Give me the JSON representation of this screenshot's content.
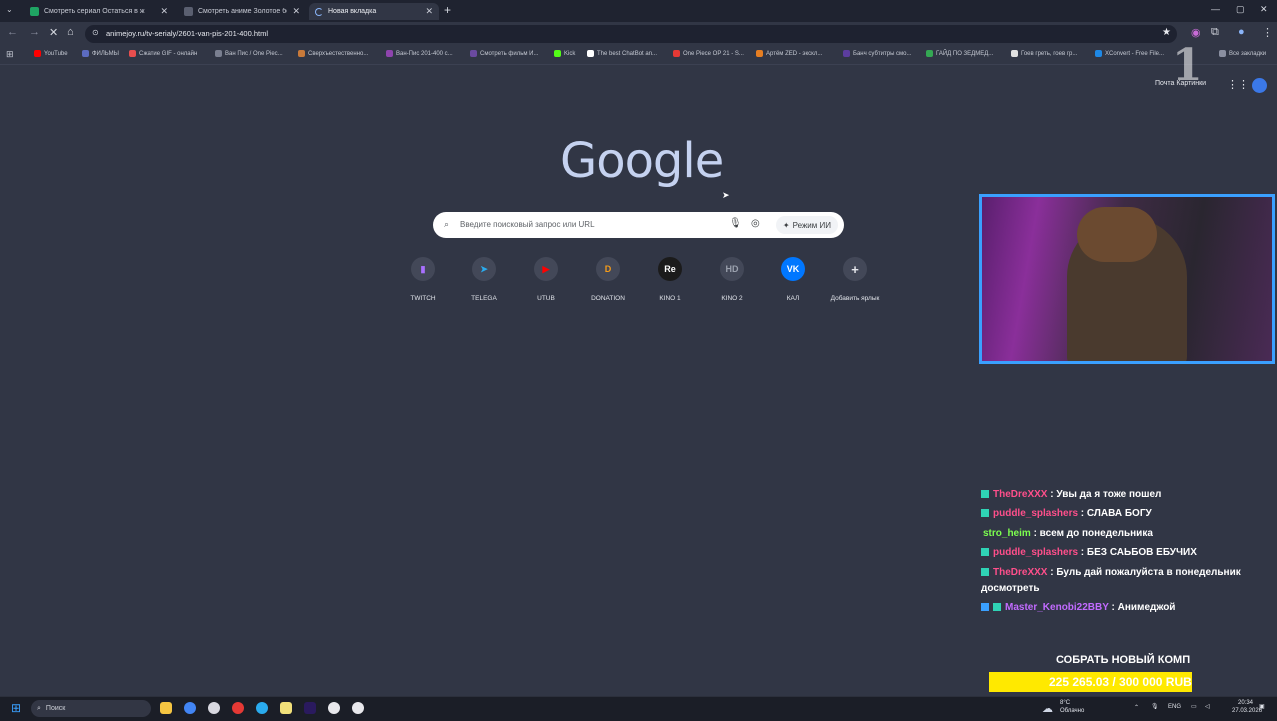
{
  "browser": {
    "tabs": [
      {
        "title": "Смотреть сериал Остаться в ж",
        "color": "#1fa463"
      },
      {
        "title": "Смотреть аниме Золотое бож",
        "color": "#5a5f70"
      },
      {
        "title": "Новая вкладка",
        "color": "#8ab4f8"
      }
    ],
    "new_tab_glyph": "+",
    "url": "animejoy.ru/tv-serialy/2601-van-pis-201-400.html",
    "bookmarks": [
      {
        "label": "YouTube",
        "color": "#ff0000"
      },
      {
        "label": "ФИЛЬМЫ",
        "color": "#5c6bc0"
      },
      {
        "label": "Сжатие GIF - онлайн",
        "color": "#e84e4e"
      },
      {
        "label": "Ван Пис / One Piec...",
        "color": "#7a7f90"
      },
      {
        "label": "Сверхъестественно...",
        "color": "#c97a3a"
      },
      {
        "label": "Ван-Пис 201-400 с...",
        "color": "#8e44ad"
      },
      {
        "label": "Смотреть фильм И...",
        "color": "#6b4aa0"
      },
      {
        "label": "Kick",
        "color": "#53fc18"
      },
      {
        "label": "The best ChatBot an...",
        "color": "#ffffff"
      },
      {
        "label": "One Piece OP 21 - S...",
        "color": "#e53935"
      },
      {
        "label": "Артём ZED - экскл...",
        "color": "#e67e22"
      },
      {
        "label": "Банч субтитры смо...",
        "color": "#5c3d9e"
      },
      {
        "label": "ГАЙД ПО ЗЕДМЕД...",
        "color": "#34a853"
      },
      {
        "label": "Гоев греть, гоев гр...",
        "color": "#e0e0e0"
      },
      {
        "label": "XConvert - Free File...",
        "color": "#1e88e5"
      }
    ],
    "all_bookmarks": "Все закладки"
  },
  "newtab": {
    "top_links": "Почта  Картинки",
    "logo": "Google",
    "search_placeholder": "Введите поисковый запрос или URL",
    "ai_mode": "Режим ИИ",
    "shortcuts": [
      {
        "label": "TWITCH",
        "glyph": "▮",
        "color": "#a970ff"
      },
      {
        "label": "TELEGA",
        "glyph": "➤",
        "color": "#2aabee"
      },
      {
        "label": "UTUB",
        "glyph": "▶",
        "color": "#ff0000"
      },
      {
        "label": "DONATION",
        "glyph": "D",
        "color": "#f59c1a"
      },
      {
        "label": "KINO 1",
        "glyph": "Re",
        "color": "#ffffff"
      },
      {
        "label": "KINO 2",
        "glyph": "HD",
        "color": "#9aa0ad"
      },
      {
        "label": "КАЛ",
        "glyph": "VK",
        "color": "#0077ff"
      },
      {
        "label": "Добавить ярлык",
        "glyph": "+",
        "color": "#e3e5ea"
      }
    ]
  },
  "stream": {
    "chat": [
      {
        "user": "TheDreXXX",
        "user_color": "#ff4f8b",
        "text": " : Увы да я тоже пошел"
      },
      {
        "user": "puddle_splashers",
        "user_color": "#ff4f8b",
        "text": " : СЛАВА БОГУ"
      },
      {
        "user": "stro_heim",
        "user_color": "#7cff4f",
        "text": " : всем до понедельника"
      },
      {
        "user": "puddle_splashers",
        "user_color": "#ff4f8b",
        "text": " : БЕЗ САЬБОВ ЕБУЧИХ"
      },
      {
        "user": "TheDreXXX",
        "user_color": "#ff4f8b",
        "text": " : Буль дай пожалуйста в понедельник досмотреть"
      },
      {
        "user": "Master_Kenobi22BBY",
        "user_color": "#c26bff",
        "text": " : Анимеджой"
      }
    ],
    "goal_title": "СОБРАТЬ НОВЫЙ КОМП",
    "goal_progress": "225 265.03 / 300 000 RUB",
    "goal_fraction": 0.75
  },
  "taskbar": {
    "search": "Поиск",
    "weather_temp": "8°C",
    "weather_desc": "Облачно",
    "lang": "ENG",
    "time": "20:34",
    "date": "27.03.2026"
  }
}
